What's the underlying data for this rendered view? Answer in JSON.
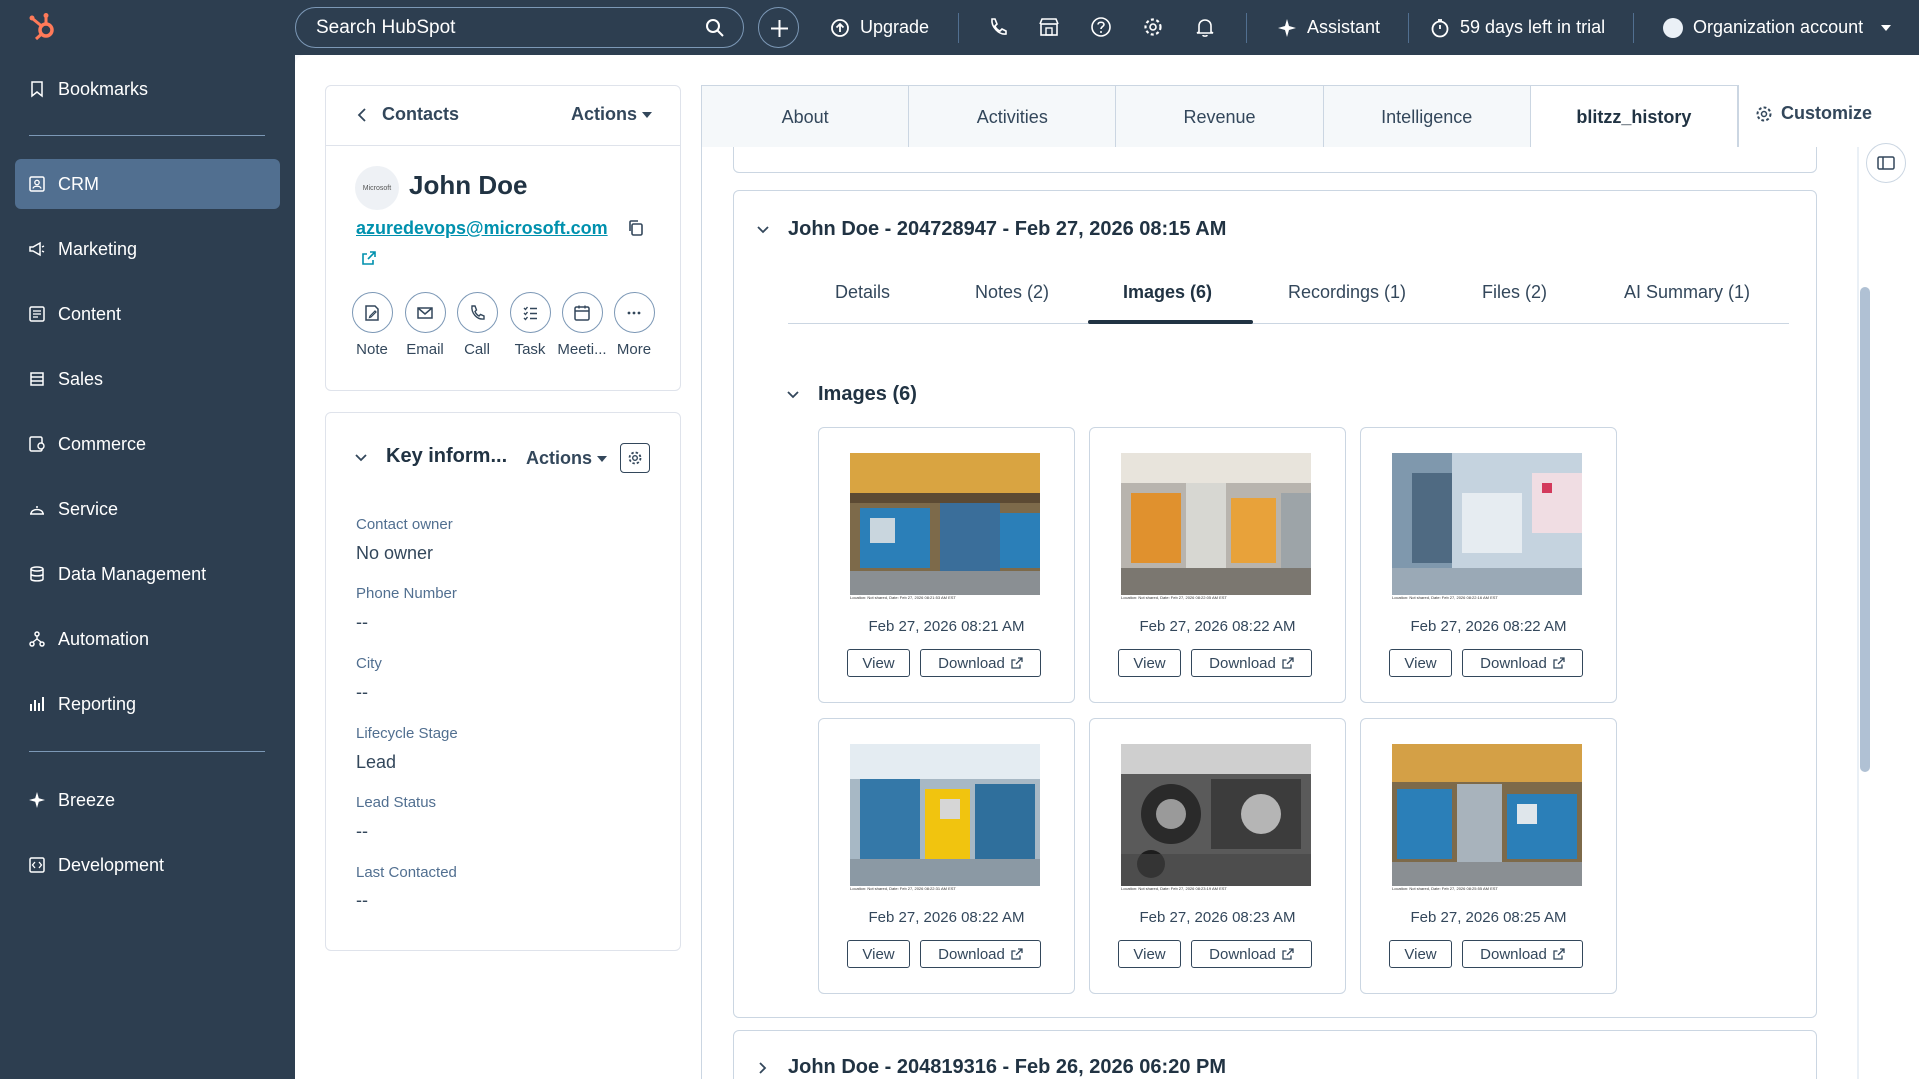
{
  "topbar": {
    "search_placeholder": "Search HubSpot",
    "upgrade": "Upgrade",
    "assistant": "Assistant",
    "trial": "59 days left in trial",
    "account": "Organization account"
  },
  "sidebar": {
    "items": [
      {
        "label": "Bookmarks",
        "icon": "bookmark-icon"
      },
      {
        "label": "CRM",
        "icon": "crm-icon"
      },
      {
        "label": "Marketing",
        "icon": "megaphone-icon"
      },
      {
        "label": "Content",
        "icon": "content-icon"
      },
      {
        "label": "Sales",
        "icon": "sales-icon"
      },
      {
        "label": "Commerce",
        "icon": "commerce-icon"
      },
      {
        "label": "Service",
        "icon": "service-icon"
      },
      {
        "label": "Data Management",
        "icon": "database-icon"
      },
      {
        "label": "Automation",
        "icon": "automation-icon"
      },
      {
        "label": "Reporting",
        "icon": "reporting-icon"
      },
      {
        "label": "Breeze",
        "icon": "sparkle-icon"
      },
      {
        "label": "Development",
        "icon": "code-icon"
      }
    ]
  },
  "contact_card": {
    "back_label": "Contacts",
    "actions_label": "Actions",
    "avatar_text": "Microsoft",
    "name": "John Doe",
    "email": "azuredevops@microsoft.com",
    "quick_actions": [
      "Note",
      "Email",
      "Call",
      "Task",
      "Meeti...",
      "More"
    ]
  },
  "key_info": {
    "title": "Key inform...",
    "actions_label": "Actions",
    "properties": [
      {
        "label": "Contact owner",
        "value": "No owner"
      },
      {
        "label": "Phone Number",
        "value": "--"
      },
      {
        "label": "City",
        "value": "--"
      },
      {
        "label": "Lifecycle Stage",
        "value": "Lead"
      },
      {
        "label": "Lead Status",
        "value": "--"
      },
      {
        "label": "Last Contacted",
        "value": "--"
      }
    ]
  },
  "tabs": [
    "About",
    "Activities",
    "Revenue",
    "Intelligence",
    "blitzz_history"
  ],
  "customize_label": "Customize",
  "record1": {
    "title": "John Doe - 204728947 - Feb 27, 2026 08:15 AM",
    "subtabs": [
      "Details",
      "Notes (2)",
      "Images (6)",
      "Recordings (1)",
      "Files (2)",
      "AI Summary (1)"
    ],
    "images_section_title": "Images (6)",
    "images": [
      {
        "date": "Feb 27, 2026 08:21 AM",
        "caption": "Location: Not shared, Date: Feb 27, 2026 08:21:53 AM EST"
      },
      {
        "date": "Feb 27, 2026 08:22 AM",
        "caption": "Location: Not shared, Date: Feb 27, 2026 08:22:05 AM EST"
      },
      {
        "date": "Feb 27, 2026 08:22 AM",
        "caption": "Location: Not shared, Date: Feb 27, 2026 08:22:16 AM EST"
      },
      {
        "date": "Feb 27, 2026 08:22 AM",
        "caption": "Location: Not shared, Date: Feb 27, 2026 08:22:31 AM EST"
      },
      {
        "date": "Feb 27, 2026 08:23 AM",
        "caption": "Location: Not shared, Date: Feb 27, 2026 08:23:19 AM EST"
      },
      {
        "date": "Feb 27, 2026 08:25 AM",
        "caption": "Location: Not shared, Date: Feb 27, 2026 08:25:55 AM EST"
      }
    ],
    "view_label": "View",
    "download_label": "Download"
  },
  "record2": {
    "title": "John Doe - 204819316 - Feb 26, 2026 06:20 PM"
  },
  "colors": {
    "nav_bg": "#2d3e50",
    "active_nav": "#516f90",
    "link": "#0091ae",
    "logo": "#ff7a59"
  }
}
